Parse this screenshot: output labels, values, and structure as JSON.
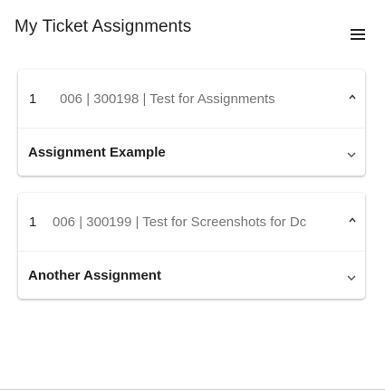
{
  "header": {
    "title": "My Ticket Assignments",
    "menu_icon": "menu-icon"
  },
  "groups": [
    {
      "count": "1",
      "title": "006 | 300198 | Test for Assignments",
      "expand_icon": "chevron-up-icon",
      "items": [
        {
          "label": "Assignment Example",
          "icon": "chevron-down-icon"
        }
      ]
    },
    {
      "count": "1",
      "title": "006 | 300199 | Test for Screenshots for Dc",
      "expand_icon": "chevron-up-icon",
      "items": [
        {
          "label": "Another Assignment",
          "icon": "chevron-down-icon"
        }
      ]
    }
  ],
  "colors": {
    "title_text": "#222222",
    "muted_text": "#757575",
    "card_bg": "#ffffff"
  }
}
